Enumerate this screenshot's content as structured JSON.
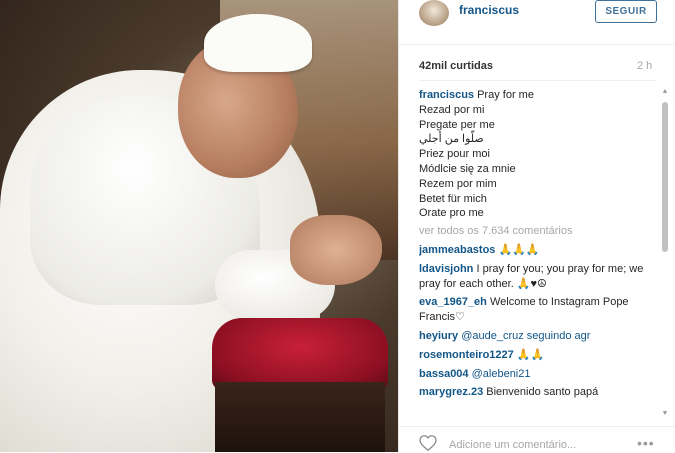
{
  "header": {
    "username": "franciscus",
    "follow_label": "SEGUIR"
  },
  "stats": {
    "likes": "42mil curtidas",
    "time": "2 h"
  },
  "caption": {
    "username": "franciscus",
    "lines": [
      "Pray for me",
      "Rezad por mi",
      "Pregate per me",
      "صلّوا من أجلي",
      "Priez pour moi",
      "Módlcie się za mnie",
      "Rezem por mim",
      "Betet für mich",
      "Orate pro me"
    ]
  },
  "view_all": "ver todos os 7.634 comentários",
  "comments": [
    {
      "user": "jammeabastos",
      "text": "🙏🙏🙏"
    },
    {
      "user": "ldavisjohn",
      "text": "I pray for you; you pray for me; we pray for each other. 🙏♥☮"
    },
    {
      "user": "eva_1967_eh",
      "text": "Welcome to Instagram Pope Francis♡"
    },
    {
      "user": "heyiury",
      "text": "@aude_cruz seguindo agr"
    },
    {
      "user": "rosemonteiro1227",
      "text": "🙏🙏"
    },
    {
      "user": "bassa004",
      "text": "@alebeni21"
    },
    {
      "user": "marygrez.23",
      "text": "Bienvenido santo papá"
    }
  ],
  "footer": {
    "add_comment_placeholder": "Adicione um comentário...",
    "more": "•••"
  }
}
